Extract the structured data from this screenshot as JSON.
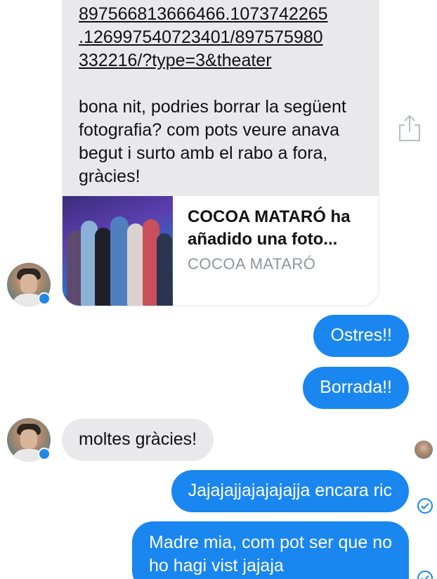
{
  "messages": {
    "incoming_link": {
      "url_text": "897566813666466.1073742265\n.126997540723401/897575980\n332216/?type=3&theater",
      "body": "bona nit, podries borrar la següent fotografia? com pots veure anava begut i surto amb el rabo a fora, gràcies!",
      "preview": {
        "title": "COCOA MATARÓ ha añadido una foto...",
        "source": "COCOA MATARÓ"
      }
    },
    "outgoing_1": "Ostres!!",
    "outgoing_2": "Borrada!!",
    "incoming_2": "moltes gràcies!",
    "outgoing_3": "Jajajajjajajajajja encara ric",
    "outgoing_4_line1": "Madre mia, com pot ser que no",
    "outgoing_4_line2": "ho hagi vist jajaja"
  },
  "icons": {
    "share": "share-icon",
    "messenger_badge": "messenger-badge-icon",
    "delivered": "delivered-check-icon"
  },
  "colors": {
    "outgoing_bubble": "#1a86f0",
    "incoming_bubble": "#e9e9eb",
    "messenger_blue": "#1e88e5"
  }
}
